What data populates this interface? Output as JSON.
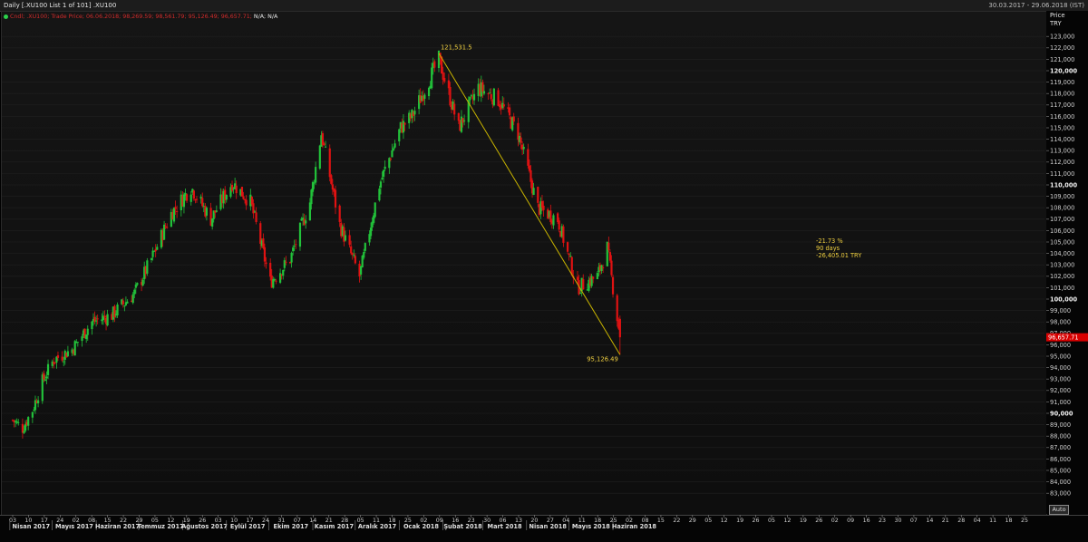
{
  "title_bar": {
    "left": "Daily [.XU100 List 1 of 101] .XU100",
    "right": "30.03.2017 - 29.06.2018 (IST)"
  },
  "legend": {
    "series": "Cndl; .XU100; Trade Price; 06.06.2018; 98,269.59; 98,561.79; 95,126.49; 96,657.71;",
    "extra": "N/A; N/A"
  },
  "price_axis": {
    "title": "Price",
    "unit": "TRY",
    "last_price_label": "96,657.71"
  },
  "auto_label": "Auto",
  "annotations": {
    "peak_label": "121,531.5",
    "low_label": "95,126.49",
    "change_pct": "-21.73 %",
    "change_days": "90 days",
    "change_value": "-26,405.01 TRY"
  },
  "colors": {
    "up": "#22c23a",
    "down": "#e01212",
    "trendline": "#c8b400",
    "label": "#f0d040",
    "last_price_bg": "#d80000"
  },
  "chart_data": {
    "type": "candlestick",
    "ylim": [
      82000,
      124000
    ],
    "y_ticks": [
      "83,000",
      "84,000",
      "85,000",
      "86,000",
      "87,000",
      "88,000",
      "89,000",
      "90,000",
      "91,000",
      "92,000",
      "93,000",
      "94,000",
      "95,000",
      "96,000",
      "97,000",
      "98,000",
      "99,000",
      "100,000",
      "101,000",
      "102,000",
      "103,000",
      "104,000",
      "105,000",
      "106,000",
      "107,000",
      "108,000",
      "109,000",
      "110,000",
      "111,000",
      "112,000",
      "113,000",
      "114,000",
      "115,000",
      "116,000",
      "117,000",
      "118,000",
      "119,000",
      "120,000",
      "121,000",
      "122,000",
      "123,000"
    ],
    "y_ticks_bold": [
      "90,000",
      "100,000",
      "110,000",
      "120,000"
    ],
    "x_day_ticks": [
      "03",
      "10",
      "17",
      "24",
      "02",
      "08",
      "15",
      "22",
      "29",
      "05",
      "12",
      "19",
      "26",
      "03",
      "10",
      "17",
      "24",
      "31",
      "07",
      "14",
      "21",
      "28",
      "05",
      "11",
      "18",
      "25",
      "02",
      "09",
      "16",
      "23",
      "30",
      "06",
      "13",
      "20",
      "27",
      "04",
      "11",
      "18",
      "25",
      "02",
      "08",
      "15",
      "22",
      "29",
      "05",
      "12",
      "19",
      "26",
      "05",
      "12",
      "19",
      "26",
      "02",
      "09",
      "16",
      "23",
      "30",
      "07",
      "14",
      "21",
      "28",
      "04",
      "11",
      "18",
      "25"
    ],
    "x_month_labels": [
      "Nisan 2017",
      "Mayıs 2017",
      "Haziran 2017",
      "Temmuz 2017",
      "Ağustos 2017",
      "Eylül 2017",
      "Ekim 2017",
      "Kasım 2017",
      "Aralık 2017",
      "Ocak 2018",
      "Şubat 2018",
      "Mart 2018",
      "Nisan 2018",
      "Mayıs 2018",
      "Haziran 2018"
    ],
    "anchor_closes": [
      {
        "date": "2017-04-03",
        "close": 89400
      },
      {
        "date": "2017-04-10",
        "close": 88700
      },
      {
        "date": "2017-04-17",
        "close": 90300
      },
      {
        "date": "2017-04-24",
        "close": 92800
      },
      {
        "date": "2017-05-02",
        "close": 94700
      },
      {
        "date": "2017-05-15",
        "close": 95600
      },
      {
        "date": "2017-05-29",
        "close": 98000
      },
      {
        "date": "2017-06-12",
        "close": 98600
      },
      {
        "date": "2017-06-28",
        "close": 100500
      },
      {
        "date": "2017-07-10",
        "close": 103500
      },
      {
        "date": "2017-07-24",
        "close": 107500
      },
      {
        "date": "2017-08-07",
        "close": 109800
      },
      {
        "date": "2017-08-21",
        "close": 107000
      },
      {
        "date": "2017-09-05",
        "close": 110200
      },
      {
        "date": "2017-09-18",
        "close": 108500
      },
      {
        "date": "2017-10-02",
        "close": 101500
      },
      {
        "date": "2017-10-16",
        "close": 103500
      },
      {
        "date": "2017-10-30",
        "close": 108500
      },
      {
        "date": "2017-11-07",
        "close": 114500
      },
      {
        "date": "2017-11-20",
        "close": 106500
      },
      {
        "date": "2017-12-04",
        "close": 102000
      },
      {
        "date": "2017-12-18",
        "close": 110000
      },
      {
        "date": "2018-01-02",
        "close": 115000
      },
      {
        "date": "2018-01-10",
        "close": 116000
      },
      {
        "date": "2018-01-29",
        "close": 121000
      },
      {
        "date": "2018-02-12",
        "close": 115000
      },
      {
        "date": "2018-02-26",
        "close": 118500
      },
      {
        "date": "2018-03-12",
        "close": 117500
      },
      {
        "date": "2018-03-26",
        "close": 114500
      },
      {
        "date": "2018-04-09",
        "close": 108000
      },
      {
        "date": "2018-04-23",
        "close": 107000
      },
      {
        "date": "2018-05-07",
        "close": 101000
      },
      {
        "date": "2018-05-21",
        "close": 102000
      },
      {
        "date": "2018-05-28",
        "close": 104500
      },
      {
        "date": "2018-06-06",
        "close": 96657.71
      }
    ],
    "trendline": {
      "from": {
        "date": "2018-01-29",
        "value": 121531.5
      },
      "to": {
        "date": "2018-06-06",
        "value": 95126.49
      }
    }
  }
}
